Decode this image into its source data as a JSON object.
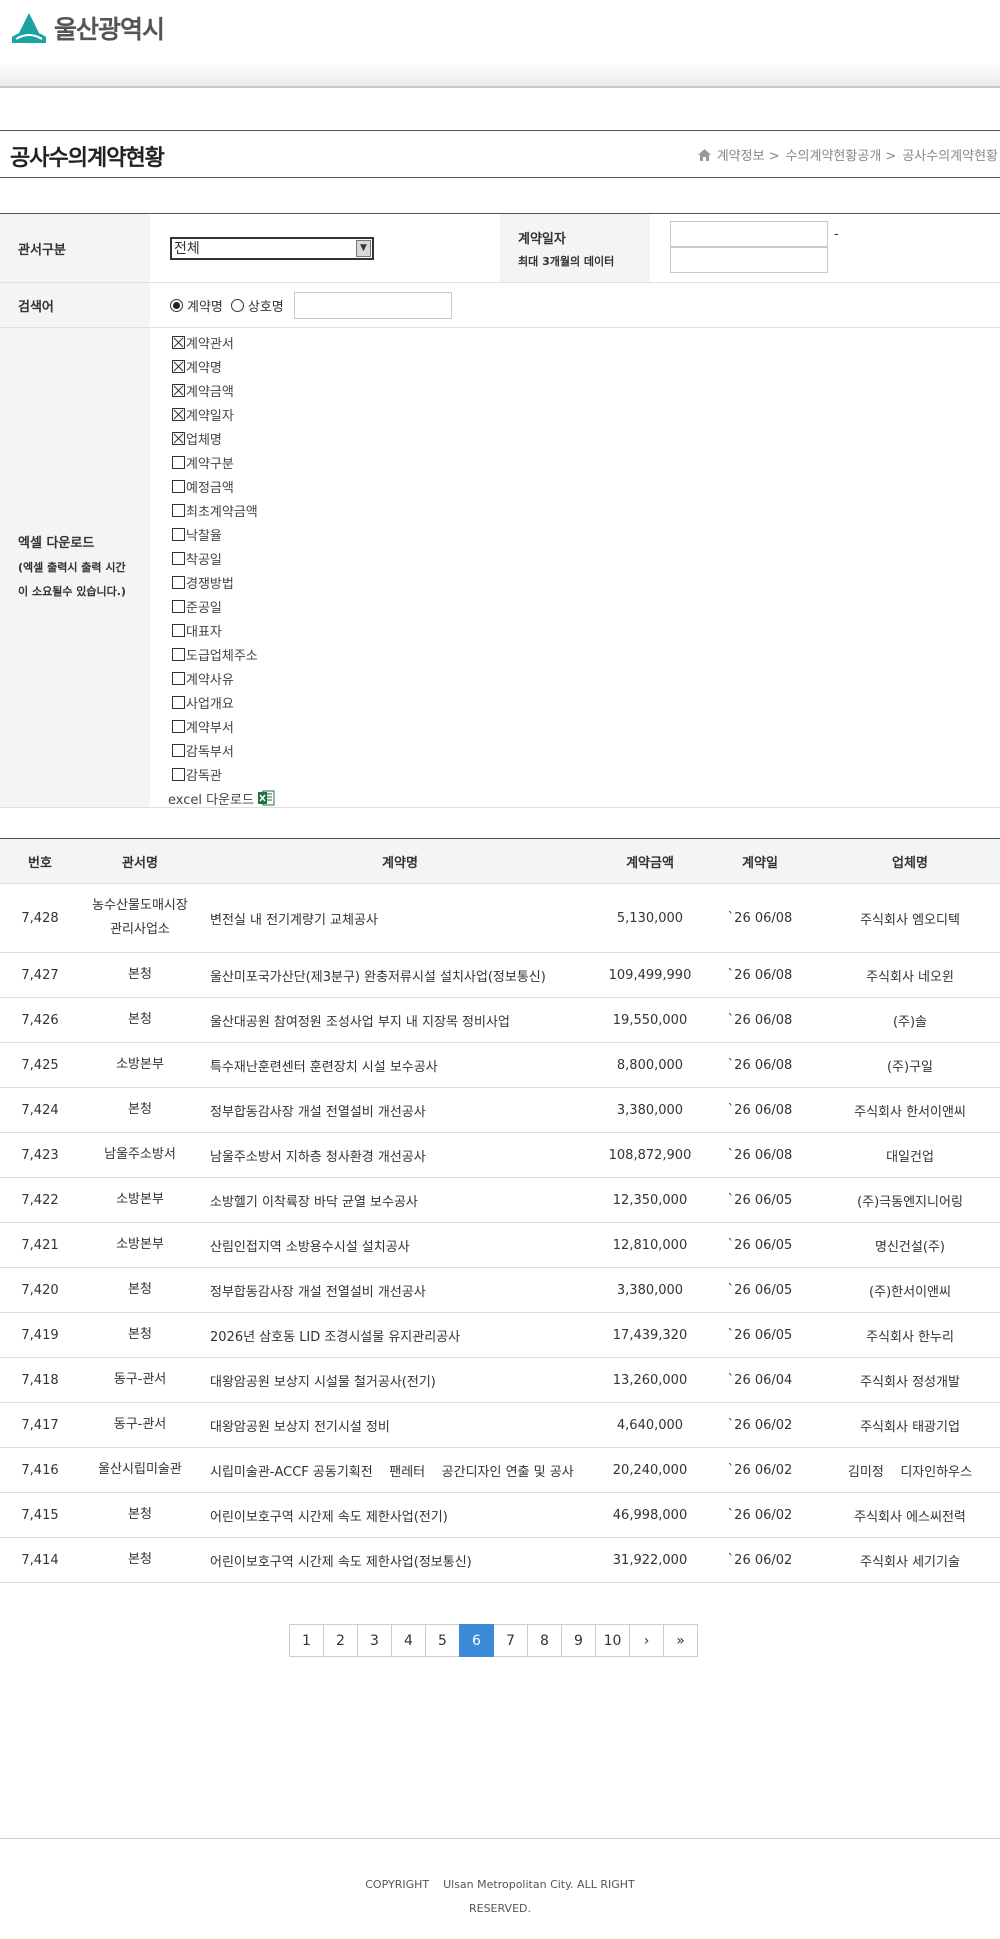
{
  "header": {
    "logo_text": "울산광역시"
  },
  "page": {
    "title": "공사수의계약현황",
    "breadcrumb": [
      "계약정보 >",
      "수의계약현황공개 >",
      "공사수의계약현황"
    ]
  },
  "search": {
    "agency_label": "관서구분",
    "agency_value": "전체",
    "date_label": "계약일자",
    "date_note": "최대 3개월의 데이터",
    "date_separator": "-",
    "keyword_label": "검색어",
    "radio_contract": "계약명",
    "radio_company": "상호명",
    "excel_label": "엑셀 다운로드",
    "excel_note1": "(엑셀 출력시 출력 시간",
    "excel_note2": "이 소요될수 있습니다.)",
    "checkboxes": [
      {
        "label": "계약관서",
        "checked": true
      },
      {
        "label": "계약명",
        "checked": true
      },
      {
        "label": "계약금액",
        "checked": true
      },
      {
        "label": "계약일자",
        "checked": true
      },
      {
        "label": "업체명",
        "checked": true
      },
      {
        "label": "계약구분",
        "checked": false
      },
      {
        "label": "예정금액",
        "checked": false
      },
      {
        "label": "최초계약금액",
        "checked": false
      },
      {
        "label": "낙찰율",
        "checked": false
      },
      {
        "label": "착공일",
        "checked": false
      },
      {
        "label": "경쟁방법",
        "checked": false
      },
      {
        "label": "준공일",
        "checked": false
      },
      {
        "label": "대표자",
        "checked": false
      },
      {
        "label": "도급업체주소",
        "checked": false
      },
      {
        "label": "계약사유",
        "checked": false
      },
      {
        "label": "사업개요",
        "checked": false
      },
      {
        "label": "계약부서",
        "checked": false
      },
      {
        "label": "감독부서",
        "checked": false
      },
      {
        "label": "감독관",
        "checked": false
      }
    ],
    "excel_download": "excel 다운로드"
  },
  "table": {
    "headers": [
      "번호",
      "관서명",
      "계약명",
      "계약금액",
      "계약일",
      "업체명"
    ],
    "rows": [
      [
        "7,428",
        "농수산물도매시장\n관리사업소",
        "변전실 내 전기계량기 교체공사",
        "5,130,000",
        "`26 06/08",
        "주식회사 엠오디텍"
      ],
      [
        "7,427",
        "본청",
        "울산미포국가산단(제3분구) 완충저류시설 설치사업(정보통신)",
        "109,499,990",
        "`26 06/08",
        "주식회사 네오윈"
      ],
      [
        "7,426",
        "본청",
        "울산대공원 참여정원 조성사업 부지 내 지장목 정비사업",
        "19,550,000",
        "`26 06/08",
        "(주)솔"
      ],
      [
        "7,425",
        "소방본부",
        "특수재난훈련센터 훈련장치 시설 보수공사",
        "8,800,000",
        "`26 06/08",
        "(주)구일"
      ],
      [
        "7,424",
        "본청",
        "정부합동감사장 개설 전열설비 개선공사",
        "3,380,000",
        "`26 06/08",
        "주식회사 한서이앤씨"
      ],
      [
        "7,423",
        "남울주소방서",
        "남울주소방서 지하층 청사환경 개선공사",
        "108,872,900",
        "`26 06/08",
        "대일건업"
      ],
      [
        "7,422",
        "소방본부",
        "소방헬기 이착륙장 바닥 균열 보수공사",
        "12,350,000",
        "`26 06/05",
        "(주)극동엔지니어링"
      ],
      [
        "7,421",
        "소방본부",
        "산림인접지역 소방용수시설 설치공사",
        "12,810,000",
        "`26 06/05",
        "명신건설(주)"
      ],
      [
        "7,420",
        "본청",
        "정부합동감사장 개설 전열설비 개선공사",
        "3,380,000",
        "`26 06/05",
        "(주)한서이앤씨"
      ],
      [
        "7,419",
        "본청",
        "2026년 삼호동 LID 조경시설물 유지관리공사",
        "17,439,320",
        "`26 06/05",
        "주식회사 한누리"
      ],
      [
        "7,418",
        "동구-관서",
        "대왕암공원 보상지 시설물 철거공사(전기)",
        "13,260,000",
        "`26 06/04",
        "주식회사 정성개발"
      ],
      [
        "7,417",
        "동구-관서",
        "대왕암공원 보상지 전기시설 정비",
        "4,640,000",
        "`26 06/02",
        "주식회사 태광기업"
      ],
      [
        "7,416",
        "울산시립미술관",
        "시립미술관-ACCF 공동기획전    팬레터    공간디자인 연출 및 공사",
        "20,240,000",
        "`26 06/02",
        "김미정    디자인하우스"
      ],
      [
        "7,415",
        "본청",
        "어린이보호구역 시간제 속도 제한사업(전기)",
        "46,998,000",
        "`26 06/02",
        "주식회사 에스씨전력"
      ],
      [
        "7,414",
        "본청",
        "어린이보호구역 시간제 속도 제한사업(정보통신)",
        "31,922,000",
        "`26 06/02",
        "주식회사 세기기술"
      ]
    ]
  },
  "pagination": {
    "pages": [
      "1",
      "2",
      "3",
      "4",
      "5",
      "6",
      "7",
      "8",
      "9",
      "10"
    ],
    "current": "6",
    "next": "›",
    "last": "»"
  },
  "footer": {
    "line1": "COPYRIGHT    Ulsan Metropolitan City. ALL RIGHT",
    "line2": "RESERVED."
  },
  "colors": {
    "accent": "#3b8ad8",
    "logo_teal": "#1aa3a0",
    "table_border": "#4a5560"
  }
}
